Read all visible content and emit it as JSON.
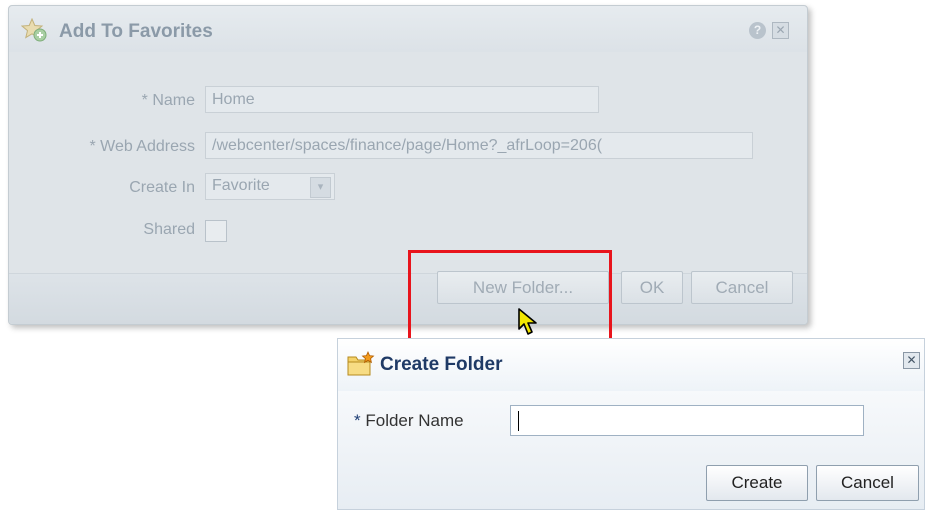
{
  "background_dialog": {
    "title": "Add To Favorites",
    "help_label": "?",
    "close_label": "✕",
    "fields": {
      "name_label": "* Name",
      "name_value": "Home",
      "web_address_label": "* Web Address",
      "web_address_value": "/webcenter/spaces/finance/page/Home?_afrLoop=206(",
      "create_in_label": "Create In",
      "create_in_value": "Favorite",
      "select_arrow": "▾",
      "shared_label": "Shared",
      "shared_checked": false
    },
    "buttons": {
      "new_folder": "New Folder...",
      "ok": "OK",
      "cancel": "Cancel"
    }
  },
  "create_folder_dialog": {
    "title": "Create Folder",
    "close_label": "✕",
    "required_marker": "*",
    "folder_name_label": "Folder Name",
    "folder_name_value": "",
    "buttons": {
      "create": "Create",
      "cancel": "Cancel"
    }
  },
  "icons": {
    "favorites": "star-add-icon",
    "folder": "new-folder-icon",
    "cursor": "arrow-cursor-icon"
  },
  "colors": {
    "highlight": "#e8141c",
    "title_blue": "#1f3a66"
  }
}
